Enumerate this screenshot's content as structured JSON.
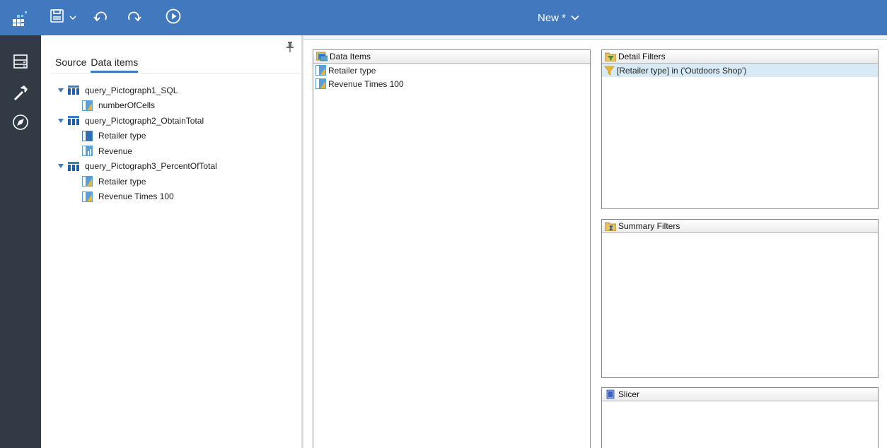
{
  "header": {
    "title": "New *"
  },
  "source_panel": {
    "tabs": [
      {
        "label": "Source",
        "active": false
      },
      {
        "label": "Data items",
        "active": true
      }
    ],
    "tree": [
      {
        "label": "query_Pictograph1_SQL",
        "children": [
          {
            "label": "numberOfCells",
            "icon": "calculated-item-icon"
          }
        ]
      },
      {
        "label": "query_Pictograph2_ObtainTotal",
        "children": [
          {
            "label": "Retailer type",
            "icon": "data-item-icon"
          },
          {
            "label": "Revenue",
            "icon": "measure-item-icon"
          }
        ]
      },
      {
        "label": "query_Pictograph3_PercentOfTotal",
        "children": [
          {
            "label": "Retailer type",
            "icon": "calculated-item-icon"
          },
          {
            "label": "Revenue Times 100",
            "icon": "calculated-item-icon"
          }
        ]
      }
    ]
  },
  "data_items_panel": {
    "title": "Data Items",
    "items": [
      {
        "label": "Retailer type"
      },
      {
        "label": "Revenue Times 100"
      }
    ]
  },
  "detail_filters_panel": {
    "title": "Detail Filters",
    "items": [
      {
        "label": "[Retailer type] in ('Outdoors Shop')"
      }
    ]
  },
  "summary_filters_panel": {
    "title": "Summary Filters"
  },
  "slicer_panel": {
    "title": "Slicer"
  },
  "colors": {
    "header_bg": "#4178be",
    "rail_bg": "#323a45",
    "selected_row": "#d8ebf5",
    "accent": "#4178be"
  }
}
